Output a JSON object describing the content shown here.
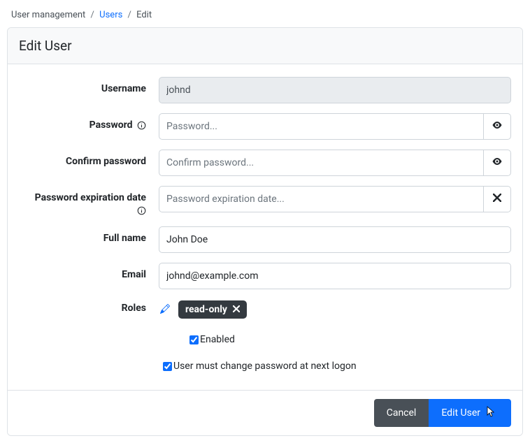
{
  "breadcrumb": {
    "root": "User management",
    "mid": "Users",
    "leaf": "Edit"
  },
  "header": {
    "title": "Edit User"
  },
  "labels": {
    "username": "Username",
    "password": "Password",
    "confirm": "Confirm password",
    "expiration": "Password expiration date",
    "fullname": "Full name",
    "email": "Email",
    "roles": "Roles"
  },
  "values": {
    "username": "johnd",
    "fullname": "John Doe",
    "email": "johnd@example.com"
  },
  "placeholders": {
    "password": "Password...",
    "confirm": "Confirm password...",
    "expiration": "Password expiration date..."
  },
  "roles": {
    "chip": "read-only"
  },
  "checkboxes": {
    "enabled": {
      "label": "Enabled",
      "checked": true
    },
    "must_change": {
      "label": "User must change password at next logon",
      "checked": true
    }
  },
  "footer": {
    "cancel": "Cancel",
    "submit": "Edit User"
  }
}
